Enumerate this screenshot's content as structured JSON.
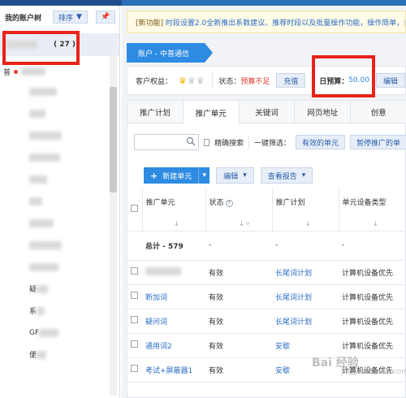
{
  "sidebar": {
    "title": "我的账户树",
    "sort_label": "排序",
    "account_count": "( 27 )",
    "root_prefix": "普",
    "tree_items": [
      {
        "label": "",
        "blur_w": 34
      },
      {
        "label": "",
        "blur_w": 20
      },
      {
        "label": "",
        "blur_w": 40
      },
      {
        "label": "",
        "blur_w": 38
      },
      {
        "label": "",
        "blur_w": 22
      },
      {
        "label": "",
        "blur_w": 16
      },
      {
        "label": "",
        "blur_w": 30
      },
      {
        "label": "",
        "blur_w": 40
      },
      {
        "label": "",
        "blur_w": 36
      },
      {
        "label": "疑",
        "blur_w": 14
      },
      {
        "label": "系",
        "blur_w": 10
      },
      {
        "label": "GF",
        "blur_w": 24
      },
      {
        "label": "便",
        "blur_w": 12
      }
    ]
  },
  "main": {
    "notice": {
      "tag": "[新功能]",
      "text": "时段设置2.0全新推出系数建议、推荐时段以及批量操作功能，操作简单，自"
    },
    "account_tab": "账户 - 中普通信",
    "infobar": {
      "benefit_label": "客户权益：",
      "status_label": "状态：",
      "status_value": "预算不足",
      "recharge": "充值",
      "budget_label": "日预算：",
      "budget_value": "50.00",
      "edit": "编辑"
    },
    "tabs": [
      "推广计划",
      "推广单元",
      "关键词",
      "网页地址",
      "创意"
    ],
    "filter": {
      "search_placeholder": "",
      "exact_search": "精确搜索",
      "quick_filter": "一键筛选：",
      "tag_valid": "有效的单元",
      "tag_paused": "暂停推广的单"
    },
    "actions": {
      "new_unit": "新建单元",
      "edit": "编辑",
      "report": "查看报告"
    },
    "table": {
      "headers": [
        "推广单元",
        "状态",
        "推广计划",
        "单元设备类型"
      ],
      "total_label": "总计 - 579",
      "total_cells": [
        "-",
        "-",
        "-"
      ],
      "rows": [
        {
          "unit": "",
          "status": "有效",
          "plan": "长尾词计划",
          "device": "计算机设备优先",
          "blurred": true
        },
        {
          "unit": "新加词",
          "status": "有效",
          "plan": "长尾词计划",
          "device": "计算机设备优先",
          "blurred": false
        },
        {
          "unit": "疑问词",
          "status": "有效",
          "plan": "长尾词计划",
          "device": "计算机设备优先",
          "blurred": false
        },
        {
          "unit": "通用词2",
          "status": "有效",
          "plan": "安歇",
          "device": "计算机设备优先",
          "blurred": false
        },
        {
          "unit": "考试+屏蔽器1",
          "status": "有效",
          "plan": "安歇",
          "device": "计算机设备优先",
          "blurred": false
        }
      ]
    }
  },
  "watermark": {
    "line1": "Bai 经验",
    "line2": "jingyan.baidu.com"
  },
  "colors": {
    "accent": "#2d8be2",
    "highlight_box": "#e8231a",
    "danger": "#e23b2e",
    "star": "#f2b200"
  }
}
